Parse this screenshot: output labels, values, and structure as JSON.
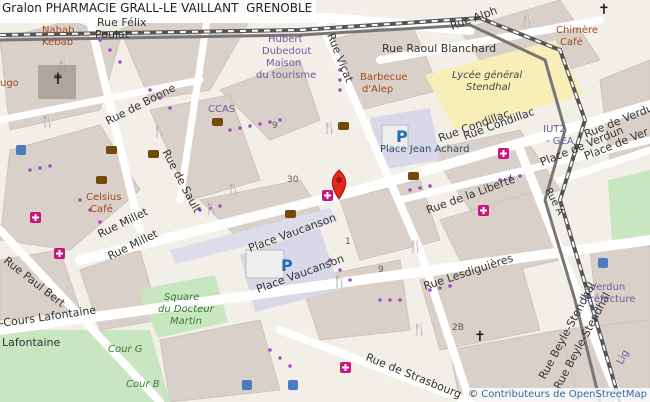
{
  "map_title": "Gralon PHARMACIE GRALL-LE VAILLANT  GRENOBLE",
  "attribution": {
    "prefix": "© ",
    "link_text": "Contributeurs de OpenStreetMap"
  },
  "streets": {
    "rue_felix_poulat_1": "Rue Félix",
    "rue_felix_poulat_2": "Poulat",
    "rue_de_bonne": "Rue de Bonne",
    "rue_de_sault": "Rue de Sault",
    "rue_millet_1": "Rue Millet",
    "rue_millet_2": "Rue Millet",
    "rue_viclet": "Rue Vicat",
    "rue_raoul_blanchard": "Rue Raoul Blanchard",
    "rue_alpes": "Rue Alph",
    "rue_condillac_1": "Rue Condillac",
    "rue_condillac_2": "Rue Condillac",
    "rue_de_la_liberte": "Rue de la Liberté",
    "rue_lesdiguieres": "Rue Lesdiguières",
    "rue_de_strasbourg": "Rue de Strasbourg",
    "place_vaucanson_1": "Place Vaucanson",
    "place_vaucanson_2": "Place Vaucanson",
    "rue_paul_bert": "Rue Paul Bert",
    "cours_lafontaine": "-Cours Lafontaine",
    "lafontaine": "Lafontaine",
    "place_de_verdun": "Place de Verdun",
    "rue_de_verdun": "Rue de Verdun",
    "rue_beyle_stendhal_1": "Rue Beyle-Stendhal",
    "rue_beyle_stendhal_2": "Rue Beyle-Stendhal",
    "place_de_verdun_2": "Place de Ver",
    "place_jean_achard": "Place Jean Achard",
    "rue_a": "Rue A",
    "lycee_1": "Lycée général",
    "lycee_2": "Stendhal"
  },
  "places": {
    "nabab_1": "Nabab",
    "nabab_2": "Kebab",
    "hubert_1": "Hubert",
    "hubert_2": "Dubedout",
    "hubert_3": "Maison",
    "hubert_4": "du tourisme",
    "barbecue_1": "Barbecue",
    "barbecue_2": "d'Alep",
    "chimere_1": "Chimère",
    "chimere_2": "Café",
    "ccas": "CCAS",
    "celsius_1": "Celsius",
    "celsius_2": "Café",
    "iut_1": "IUT2",
    "iut_2": "- GEA",
    "verdun_1": "Verdun",
    "verdun_2": "Préfecture",
    "square_1": "Square",
    "square_2": "du Docteur",
    "square_3": "Martin",
    "cour_g": "Cour G",
    "cour_b": "Cour B",
    "ugo": "ugo",
    "lig": "Lig"
  },
  "house_numbers": [
    "30",
    "9",
    "2B",
    "9",
    "1"
  ],
  "parking_label": "P",
  "colors": {
    "background": "#f2efe9",
    "block": "#d9d0c9",
    "road": "#ffffff",
    "railway": "#6e6e6e",
    "poi_brown": "#734a08",
    "pharmacy": "#c7177f",
    "pedestrian": "#a9a9c9",
    "park": "#c8e6c0",
    "dots": "#a44dc0",
    "marker": "#e8271c"
  }
}
